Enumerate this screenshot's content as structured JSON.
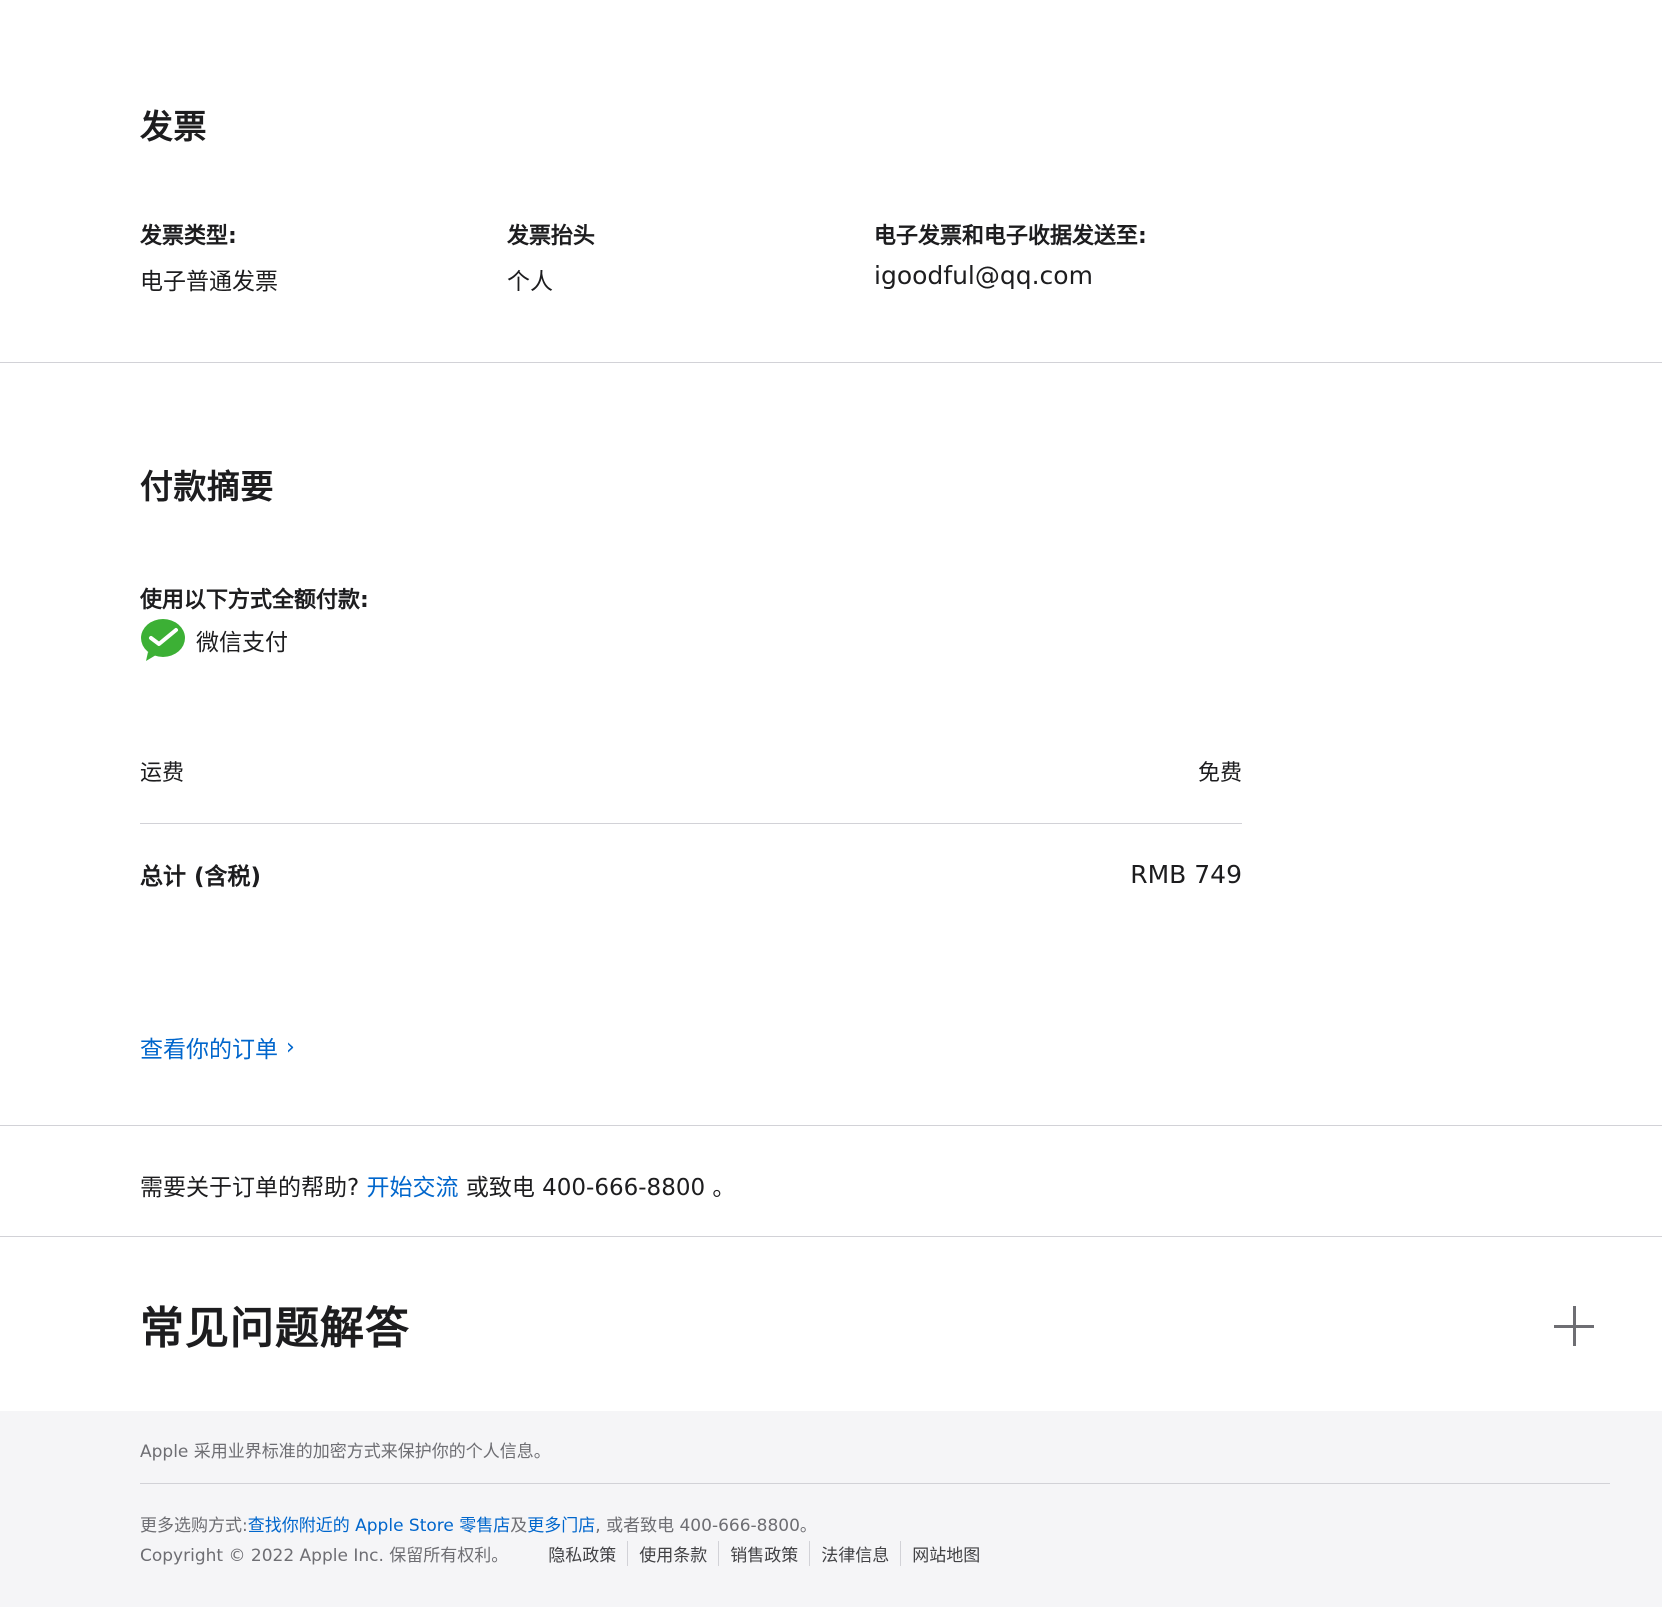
{
  "invoice": {
    "title": "发票",
    "type_label": "发票类型:",
    "type_value": "电子普通发票",
    "header_label": "发票抬头",
    "header_value": "个人",
    "email_label": "电子发票和电子收据发送至:",
    "email_value": "igoodful@qq.com"
  },
  "payment": {
    "title": "付款摘要",
    "method_label": "使用以下方式全额付款:",
    "method_name": "微信支付",
    "method_icon": "wechat-pay-icon",
    "brand_color": "#3cb035"
  },
  "summary": {
    "shipping_label": "运费",
    "shipping_value": "免费",
    "total_label": "总计 (含税)",
    "total_value": "RMB 749"
  },
  "view_order": {
    "label": "查看你的订单",
    "chevron": "›"
  },
  "help": {
    "prefix": "需要关于订单的帮助?",
    "link": "开始交流",
    "middle": "或致电",
    "phone": "400-666-8800",
    "suffix": "。"
  },
  "faq": {
    "title": "常见问题解答",
    "toggle_icon": "plus-icon"
  },
  "footer": {
    "secure_text": "Apple 采用业界标准的加密方式来保护你的个人信息。",
    "more_prefix": "更多选购方式:",
    "find_store_link": "查找你附近的 Apple Store 零售店",
    "and": "及",
    "more_stores_link": "更多门店",
    "call_text": ", 或者致电 400-666-8800。",
    "copyright": "Copyright © 2022 Apple Inc. 保留所有权利。",
    "links": [
      "隐私政策",
      "使用条款",
      "销售政策",
      "法律信息",
      "网站地图"
    ]
  },
  "colors": {
    "link": "#0066cc",
    "text": "#1d1d1f",
    "secondary": "#6e6e73",
    "divider": "#d2d2d7",
    "footer_bg": "#f5f5f7"
  }
}
